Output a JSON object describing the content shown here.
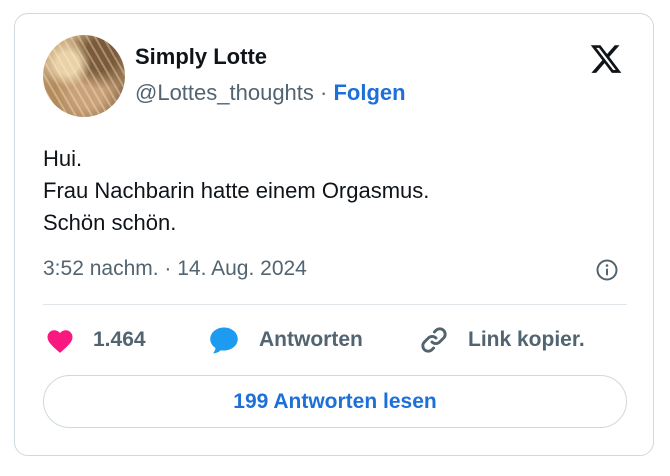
{
  "author": {
    "name": "Simply Lotte",
    "handle": "@Lottes_thoughts",
    "separator": "·",
    "follow_label": "Folgen"
  },
  "tweet": {
    "lines": [
      "Hui.",
      "Frau Nachbarin hatte einem Orgasmus.",
      "Schön schön."
    ],
    "timestamp": "3:52 nachm. · 14. Aug. 2024"
  },
  "actions": {
    "like_count": "1.464",
    "reply_label": "Antworten",
    "copy_link_label": "Link kopier."
  },
  "read_replies_label": "199 Antworten lesen",
  "icons": {
    "brand": "x-logo-icon",
    "info": "info-icon",
    "like": "heart-icon",
    "reply": "speech-bubble-icon",
    "copy": "link-icon"
  },
  "colors": {
    "heart": "#f91880",
    "reply_bubble": "#1d9bf0",
    "link_blue": "#1d6fd9",
    "secondary_text": "#536471"
  }
}
